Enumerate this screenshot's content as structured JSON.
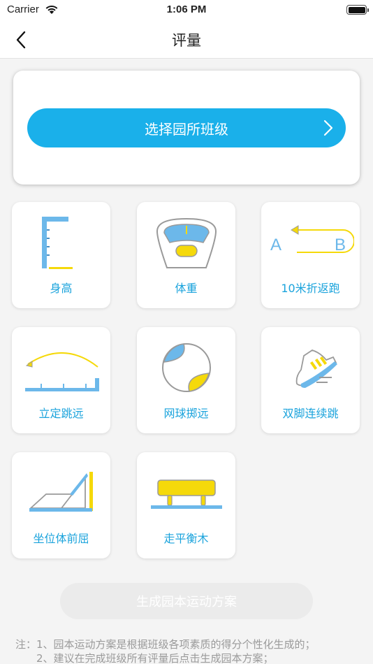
{
  "status_bar": {
    "carrier": "Carrier",
    "time": "1:06 PM"
  },
  "nav": {
    "title": "评量"
  },
  "class_selector": {
    "label": "选择园所班级"
  },
  "items": [
    {
      "label": "身高",
      "icon": "height-measure-icon"
    },
    {
      "label": "体重",
      "icon": "weight-scale-icon"
    },
    {
      "label": "10米折返跑",
      "icon": "shuttle-run-icon"
    },
    {
      "label": "立定跳远",
      "icon": "standing-long-jump-icon"
    },
    {
      "label": "网球掷远",
      "icon": "tennis-ball-throw-icon"
    },
    {
      "label": "双脚连续跳",
      "icon": "jumping-shoe-icon"
    },
    {
      "label": "坐位体前屈",
      "icon": "sit-and-reach-icon"
    },
    {
      "label": "走平衡木",
      "icon": "balance-beam-icon"
    }
  ],
  "generate_button": {
    "label": "生成园本运动方案"
  },
  "notes": {
    "line1": "注：1、园本运动方案是根据班级各项素质的得分个性化生成的；",
    "line2": "2、建议在完成班级所有评量后点击生成园本方案；"
  },
  "colors": {
    "accent": "#1ab0ea",
    "icon_blue": "#6cb8ea",
    "icon_yellow": "#f5d90a",
    "label_blue": "#1aa3dc"
  }
}
